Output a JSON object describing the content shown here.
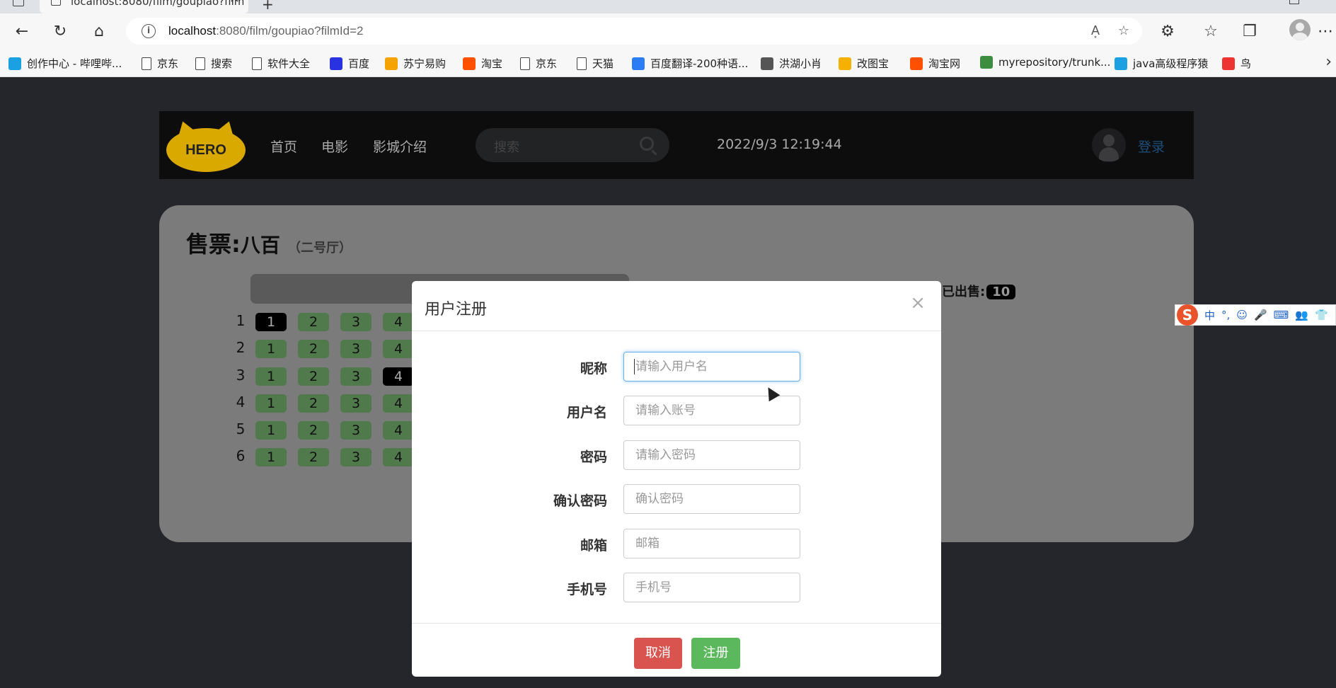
{
  "browser": {
    "tab_title": "localhost:8080/film/goupiao?film",
    "url_host": "localhost",
    "url_rest": ":8080/film/goupiao?filmId=2",
    "bookmarks": [
      {
        "label": "创作中心 - 哔哩哔...",
        "icon": "bilibili-icon",
        "color": "#1ba1e2"
      },
      {
        "label": "京东",
        "icon": "page-icon"
      },
      {
        "label": "搜索",
        "icon": "page-icon"
      },
      {
        "label": "软件大全",
        "icon": "page-icon"
      },
      {
        "label": "百度",
        "icon": "baidu-icon",
        "color": "#2932e1"
      },
      {
        "label": "苏宁易购",
        "icon": "suning-icon",
        "color": "#f5a300"
      },
      {
        "label": "淘宝",
        "icon": "taobao-icon",
        "color": "#ff5000"
      },
      {
        "label": "京东",
        "icon": "page-icon"
      },
      {
        "label": "天猫",
        "icon": "page-icon"
      },
      {
        "label": "百度翻译-200种语...",
        "icon": "translate-icon",
        "color": "#2c7cf5"
      },
      {
        "label": "洪湖小肖",
        "icon": "bird-icon",
        "color": "#555555"
      },
      {
        "label": "改图宝",
        "icon": "gaitubao-icon",
        "color": "#f5b000"
      },
      {
        "label": "淘宝网",
        "icon": "taobao-icon",
        "color": "#ff5000"
      },
      {
        "label": "myrepository/trunk...",
        "icon": "chrome-icon",
        "color": "#3c8d40"
      },
      {
        "label": "java高级程序猿",
        "icon": "bilibili-icon",
        "color": "#1ba1e2"
      },
      {
        "label": "鸟",
        "icon": "bird-icon",
        "color": "#e33"
      }
    ]
  },
  "site": {
    "logo_text": "HERO",
    "nav": [
      "首页",
      "电影",
      "影城介绍"
    ],
    "search_placeholder": "搜索",
    "clock": "2022/9/3 12:19:44",
    "login": "登录"
  },
  "ticket": {
    "title": "售票:",
    "film": "八百",
    "hall": "（二号厅）",
    "sold_label": "已出售:",
    "sold_count": "10",
    "rows": [
      {
        "row": "1",
        "seats": [
          {
            "n": "1",
            "sold": true
          },
          {
            "n": "2",
            "sold": false
          },
          {
            "n": "3",
            "sold": false
          },
          {
            "n": "4",
            "sold": false
          }
        ]
      },
      {
        "row": "2",
        "seats": [
          {
            "n": "1",
            "sold": false
          },
          {
            "n": "2",
            "sold": false
          },
          {
            "n": "3",
            "sold": false
          },
          {
            "n": "4",
            "sold": false
          }
        ]
      },
      {
        "row": "3",
        "seats": [
          {
            "n": "1",
            "sold": false
          },
          {
            "n": "2",
            "sold": false
          },
          {
            "n": "3",
            "sold": false
          },
          {
            "n": "4",
            "sold": true
          }
        ]
      },
      {
        "row": "4",
        "seats": [
          {
            "n": "1",
            "sold": false
          },
          {
            "n": "2",
            "sold": false
          },
          {
            "n": "3",
            "sold": false
          },
          {
            "n": "4",
            "sold": false
          }
        ]
      },
      {
        "row": "5",
        "seats": [
          {
            "n": "1",
            "sold": false
          },
          {
            "n": "2",
            "sold": false
          },
          {
            "n": "3",
            "sold": false
          },
          {
            "n": "4",
            "sold": false
          }
        ]
      },
      {
        "row": "6",
        "seats": [
          {
            "n": "1",
            "sold": false
          },
          {
            "n": "2",
            "sold": false
          },
          {
            "n": "3",
            "sold": false
          },
          {
            "n": "4",
            "sold": false
          }
        ]
      }
    ]
  },
  "modal": {
    "title": "用户注册",
    "close": "×",
    "fields": [
      {
        "label": "昵称",
        "placeholder": "请输入用户名"
      },
      {
        "label": "用户名",
        "placeholder": "请输入账号"
      },
      {
        "label": "密码",
        "placeholder": "请输入密码"
      },
      {
        "label": "确认密码",
        "placeholder": "确认密码"
      },
      {
        "label": "邮箱",
        "placeholder": "邮箱"
      },
      {
        "label": "手机号",
        "placeholder": "手机号"
      }
    ],
    "cancel": "取消",
    "submit": "注册"
  },
  "ime": {
    "logo": "S",
    "items": [
      "中",
      "°,",
      "☺",
      "🎤",
      "⌨",
      "👥",
      "👕"
    ]
  }
}
